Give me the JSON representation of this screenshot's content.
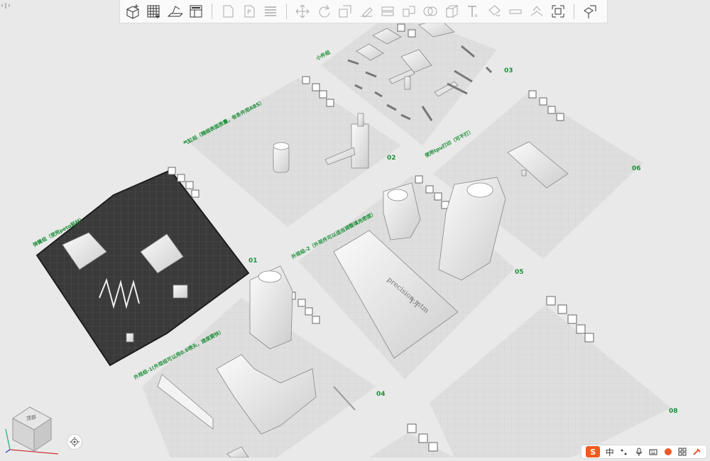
{
  "app": {
    "name": "3D slicer workspace"
  },
  "colors": {
    "label_green": "#1f8f3a",
    "plate_light": "#dcdcdc",
    "plate_dark": "#3a3a3a",
    "toolbar_bg": "#fafafa",
    "ime_orange": "#ee5b1d"
  },
  "ui": {
    "collapse_label": "‹|›"
  },
  "toolbar": {
    "groups": [
      [
        {
          "name": "add-cube-icon"
        },
        {
          "name": "grid-arrange-icon"
        },
        {
          "name": "orient-plate-icon"
        },
        {
          "name": "layout-panel-icon"
        }
      ],
      [
        {
          "name": "plate-outline-icon"
        },
        {
          "name": "plate-p-icon"
        },
        {
          "name": "layers-icon"
        }
      ],
      [
        {
          "name": "move-icon"
        },
        {
          "name": "rotate-icon"
        },
        {
          "name": "scale-icon"
        },
        {
          "name": "lay-on-face-icon"
        },
        {
          "name": "cut-icon"
        },
        {
          "name": "split-icon"
        },
        {
          "name": "boolean-icon"
        },
        {
          "name": "measure-cube-icon"
        },
        {
          "name": "text-icon"
        },
        {
          "name": "paint-icon"
        },
        {
          "name": "seam-icon"
        },
        {
          "name": "support-paint-icon"
        },
        {
          "name": "fit-view-icon"
        }
      ],
      [
        {
          "name": "assemble-view-icon"
        }
      ]
    ]
  },
  "plates": [
    {
      "num": "01",
      "label": "弹簧组（使用petg耗材）",
      "dark": true
    },
    {
      "num": "02",
      "label": "气缸组（精细表面质量，有条件用ABS）",
      "dark": false
    },
    {
      "num": "03",
      "label": "小件组",
      "dark": false
    },
    {
      "num": "04",
      "label": "外观组-1(外观组可以用0.6喷头，速度要快）",
      "dark": false
    },
    {
      "num": "05",
      "label": "外观组-2（外观件可以适当调整填充密度）",
      "dark": false
    },
    {
      "num": "06",
      "label": "使用tpu打印（可不打）",
      "dark": false
    },
    {
      "num": "08",
      "label": "",
      "dark": false
    }
  ],
  "model_text": {
    "stock_line1": "Y-1",
    "stock_line2": "precision mtm"
  },
  "navcube": {
    "label": "顶部"
  },
  "ime": {
    "logo": "S",
    "lang": "中",
    "items": [
      "punct-icon",
      "mic-icon",
      "keyboard-icon",
      "skin-icon",
      "apps-icon",
      "tools-icon"
    ]
  }
}
